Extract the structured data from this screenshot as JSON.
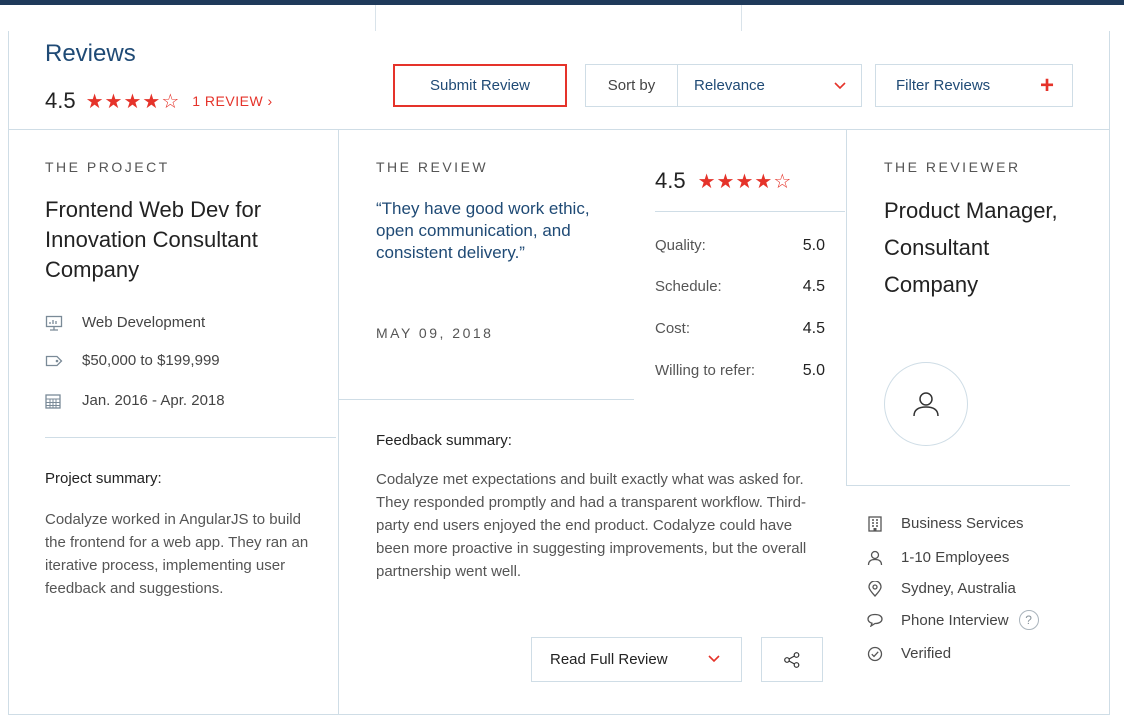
{
  "header": {
    "title": "Reviews",
    "rating": "4.5",
    "stars": "★★★★☆",
    "review_link": "1 REVIEW ›",
    "submit_label": "Submit Review",
    "sort_label": "Sort by",
    "sort_value": "Relevance",
    "filter_label": "Filter Reviews",
    "filter_plus": "+"
  },
  "project": {
    "section_label": "THE PROJECT",
    "title": "Frontend Web Dev for Innovation Consultant Company",
    "meta": [
      {
        "icon": "presentation-icon",
        "text": "Web Development"
      },
      {
        "icon": "price-tag-icon",
        "text": "$50,000 to $199,999"
      },
      {
        "icon": "calendar-icon",
        "text": "Jan. 2016 - Apr. 2018"
      }
    ],
    "summary_heading": "Project summary:",
    "summary": "Codalyze worked in AngularJS to build the frontend for a web app. They ran an iterative process, implementing user feedback and suggestions."
  },
  "review": {
    "section_label": "THE REVIEW",
    "quote": "“They have good work ethic, open communication, and consistent delivery.”",
    "date": "MAY 09, 2018",
    "score": "4.5",
    "stars": "★★★★☆",
    "ratings": [
      {
        "label": "Quality:",
        "value": "5.0"
      },
      {
        "label": "Schedule:",
        "value": "4.5"
      },
      {
        "label": "Cost:",
        "value": "4.5"
      },
      {
        "label": "Willing to refer:",
        "value": "5.0"
      }
    ],
    "feedback_heading": "Feedback summary:",
    "feedback": "Codalyze met expectations and built exactly what was asked for. They responded promptly and had a transparent workflow. Third-party end users enjoyed the end product. Codalyze could have been more proactive in suggesting improvements, but the overall partnership went well.",
    "read_full_label": "Read Full Review"
  },
  "reviewer": {
    "section_label": "THE REVIEWER",
    "name": "Product Manager, Consultant Company",
    "details": [
      {
        "icon": "building-icon",
        "text": "Business Services"
      },
      {
        "icon": "person-icon",
        "text": "1-10 Employees"
      },
      {
        "icon": "location-pin-icon",
        "text": "Sydney, Australia"
      },
      {
        "icon": "speech-bubble-icon",
        "text": "Phone Interview"
      },
      {
        "icon": "check-circle-icon",
        "text": "Verified"
      }
    ],
    "help_glyph": "?"
  },
  "colors": {
    "accent": "#e5332a",
    "navy": "#1f4a75",
    "border": "#cfdde6"
  }
}
